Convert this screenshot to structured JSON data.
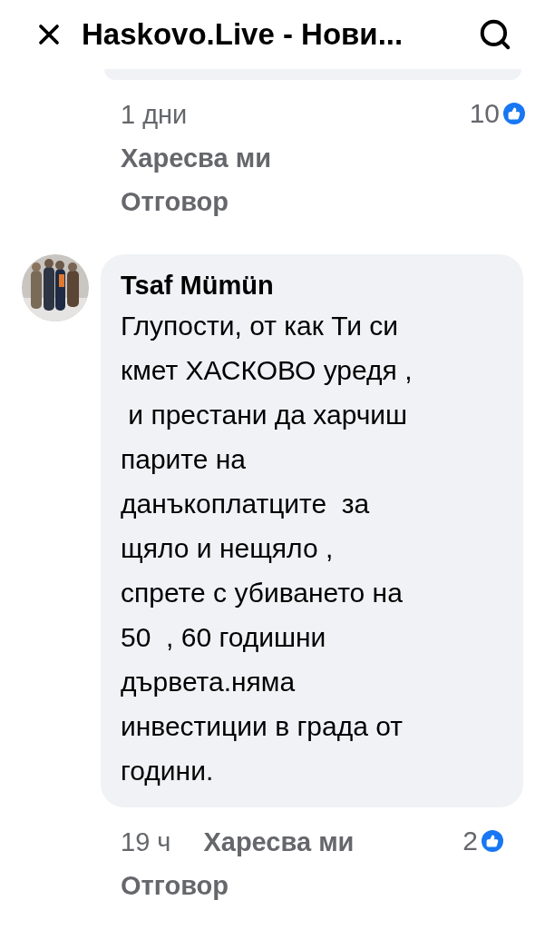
{
  "header": {
    "title": "Haskovo.Live - Нови..."
  },
  "previous_comment": {
    "time": "1 дни",
    "actions": [
      "Харесва ми",
      "Отговор"
    ],
    "likes": "10"
  },
  "comment": {
    "author": "Tsaf Mümün",
    "text": "Глупости, от как Ти си\nкмет ХАСКОВО уредя ,\n и престани да харчиш\nпарите на\nданъкоплатците  за\nщяло и нещяло ,\nспрете с убиването на\n50  , 60 годишни\nдървета.няма\nинвестиции в града от\nгодини.",
    "time": "19 ч",
    "actions": [
      "Харесва ми",
      "Отговор"
    ],
    "likes": "2"
  }
}
